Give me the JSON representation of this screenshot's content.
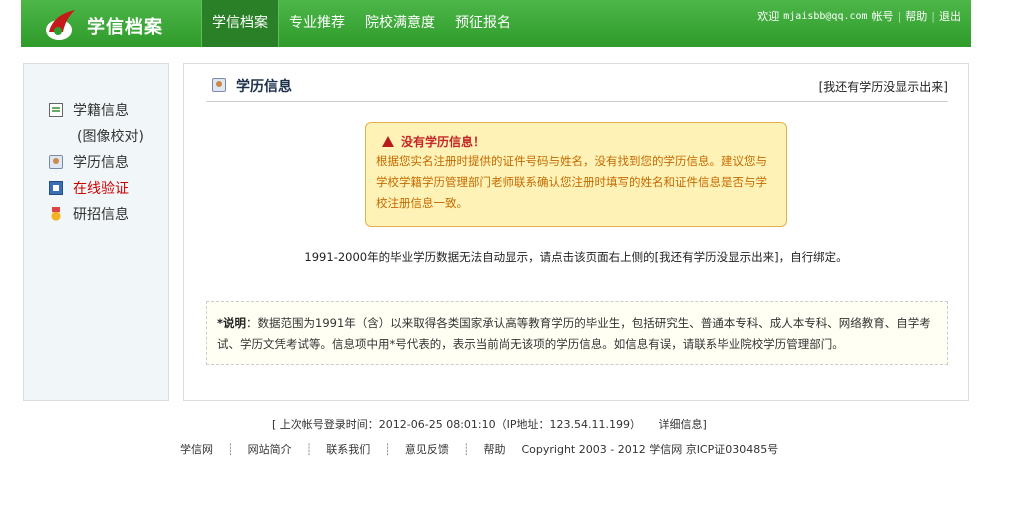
{
  "header": {
    "logo_text": "学信档案",
    "nav": [
      "学信档案",
      "专业推荐",
      "院校满意度",
      "预征报名"
    ],
    "user": {
      "welcome": "欢迎",
      "email": "mjaisbb@qq.com",
      "account": "帐号",
      "help": "帮助",
      "logout": "退出"
    }
  },
  "sidebar": {
    "items": [
      {
        "label": "学籍信息",
        "icon": "document-icon"
      },
      {
        "label": "(图像校对)",
        "icon": ""
      },
      {
        "label": "学历信息",
        "icon": "person-card-icon"
      },
      {
        "label": "在线验证",
        "icon": "verify-icon"
      },
      {
        "label": "研招信息",
        "icon": "medal-icon"
      }
    ]
  },
  "main": {
    "title": "学历信息",
    "head_link": "[我还有学历没显示出来]",
    "warning": {
      "title": "没有学历信息！",
      "text": "根据您实名注册时提供的证件号码与姓名，没有找到您的学历信息。建议您与学校学籍学历管理部门老师联系确认您注册时填写的姓名和证件信息是否与学校注册信息一致。"
    },
    "notice": "1991-2000年的毕业学历数据无法自动显示，请点击该页面右上侧的[我还有学历没显示出来]，自行绑定。",
    "explain_label": "*说明",
    "explain_text": "：数据范围为1991年（含）以来取得各类国家承认高等教育学历的毕业生，包括研究生、普通本专科、成人本专科、网络教育、自学考试、学历文凭考试等。信息项中用*号代表的，表示当前尚无该项的学历信息。如信息有误，请联系毕业院校学历管理部门。"
  },
  "footer": {
    "last_login": "[ 上次帐号登录时间：2012-06-25 08:01:10（IP地址：123.54.11.199）",
    "detail": "详细信息]",
    "links": [
      "学信网",
      "网站简介",
      "联系我们",
      "意见反馈",
      "帮助"
    ],
    "copyright": "Copyright 2003 - 2012 学信网 京ICP证030485号"
  }
}
